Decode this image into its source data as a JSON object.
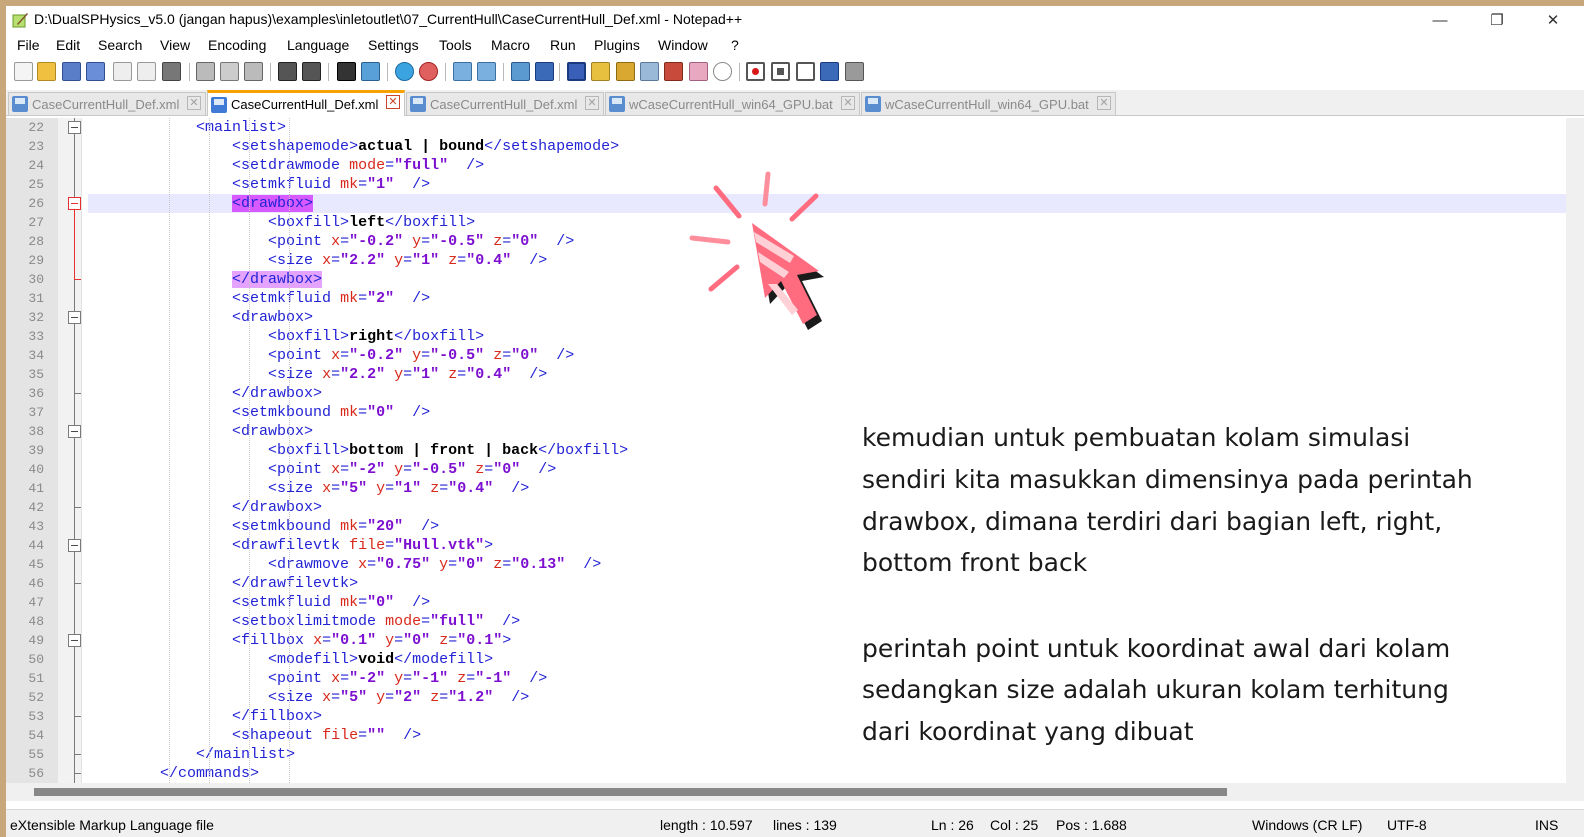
{
  "window": {
    "title": "D:\\DualSPHysics_v5.0 (jangan hapus)\\examples\\inletoutlet\\07_CurrentHull\\CaseCurrentHull_Def.xml - Notepad++",
    "minimize": "—",
    "restore": "❐",
    "close": "✕"
  },
  "menu": [
    "File",
    "Edit",
    "Search",
    "View",
    "Encoding",
    "Language",
    "Settings",
    "Tools",
    "Macro",
    "Run",
    "Plugins",
    "Window",
    "?"
  ],
  "tabs": [
    {
      "label": "CaseCurrentHull_Def.xml",
      "active": false
    },
    {
      "label": "CaseCurrentHull_Def.xml",
      "active": true
    },
    {
      "label": "CaseCurrentHull_Def.xml",
      "active": false
    },
    {
      "label": "wCaseCurrentHull_win64_GPU.bat",
      "active": false
    },
    {
      "label": "wCaseCurrentHull_win64_GPU.bat",
      "active": false
    }
  ],
  "tab_close": "✕",
  "editor": {
    "current_line": 26,
    "lines": [
      {
        "n": "22",
        "t": "            <mainlist>"
      },
      {
        "n": "23",
        "t": "                <setshapemode>actual | bound</setshapemode>"
      },
      {
        "n": "24",
        "t": "                <setdrawmode mode=\"full\" />"
      },
      {
        "n": "25",
        "t": "                <setmkfluid mk=\"1\" />"
      },
      {
        "n": "26",
        "t": "                <drawbox>"
      },
      {
        "n": "27",
        "t": "                    <boxfill>left</boxfill>"
      },
      {
        "n": "28",
        "t": "                    <point x=\"-0.2\" y=\"-0.5\" z=\"0\" />"
      },
      {
        "n": "29",
        "t": "                    <size x=\"2.2\" y=\"1\" z=\"0.4\" />"
      },
      {
        "n": "30",
        "t": "                </drawbox>"
      },
      {
        "n": "31",
        "t": "                <setmkfluid mk=\"2\" />"
      },
      {
        "n": "32",
        "t": "                <drawbox>"
      },
      {
        "n": "33",
        "t": "                    <boxfill>right</boxfill>"
      },
      {
        "n": "34",
        "t": "                    <point x=\"-0.2\" y=\"-0.5\" z=\"0\" />"
      },
      {
        "n": "35",
        "t": "                    <size x=\"2.2\" y=\"1\" z=\"0.4\" />"
      },
      {
        "n": "36",
        "t": "                </drawbox>"
      },
      {
        "n": "37",
        "t": "                <setmkbound mk=\"0\" />"
      },
      {
        "n": "38",
        "t": "                <drawbox>"
      },
      {
        "n": "39",
        "t": "                    <boxfill>bottom | front | back</boxfill>"
      },
      {
        "n": "40",
        "t": "                    <point x=\"-2\" y=\"-0.5\" z=\"0\" />"
      },
      {
        "n": "41",
        "t": "                    <size x=\"5\" y=\"1\" z=\"0.4\" />"
      },
      {
        "n": "42",
        "t": "                </drawbox>"
      },
      {
        "n": "43",
        "t": "                <setmkbound mk=\"20\" />"
      },
      {
        "n": "44",
        "t": "                <drawfilevtk file=\"Hull.vtk\">"
      },
      {
        "n": "45",
        "t": "                    <drawmove x=\"0.75\" y=\"0\" z=\"0.13\" />"
      },
      {
        "n": "46",
        "t": "                </drawfilevtk>"
      },
      {
        "n": "47",
        "t": "                <setmkfluid mk=\"0\" />"
      },
      {
        "n": "48",
        "t": "                <setboxlimitmode mode=\"full\" />"
      },
      {
        "n": "49",
        "t": "                <fillbox x=\"0.1\" y=\"0\" z=\"0.1\">"
      },
      {
        "n": "50",
        "t": "                    <modefill>void</modefill>"
      },
      {
        "n": "51",
        "t": "                    <point x=\"-2\" y=\"-1\" z=\"-1\" />"
      },
      {
        "n": "52",
        "t": "                    <size x=\"5\" y=\"2\" z=\"1.2\" />"
      },
      {
        "n": "53",
        "t": "                </fillbox>"
      },
      {
        "n": "54",
        "t": "                <shapeout file=\"\" />"
      },
      {
        "n": "55",
        "t": "            </mainlist>"
      },
      {
        "n": "56",
        "t": "        </commands>"
      }
    ]
  },
  "annotation": {
    "para1": [
      "kemudian untuk pembuatan kolam simulasi",
      "sendiri kita masukkan dimensinya pada perintah",
      "drawbox, dimana terdiri dari bagian left, right,",
      "bottom front back"
    ],
    "para2": [
      "perintah point untuk koordinat awal dari kolam",
      "sedangkan size adalah ukuran kolam terhitung",
      "dari koordinat yang dibuat"
    ]
  },
  "status": {
    "filetype": "eXtensible Markup Language file",
    "length": "length : 10.597",
    "lines": "lines : 139",
    "ln": "Ln : 26",
    "col": "Col : 25",
    "pos": "Pos : 1.688",
    "eol": "Windows (CR LF)",
    "encoding": "UTF-8",
    "mode": "INS"
  },
  "colors": {
    "tag": "#2323d6",
    "attr": "#d8291a",
    "value": "#7d0fd0",
    "cursor_pink": "#ff6b7f",
    "cursor_dark": "#1a1a1a"
  }
}
